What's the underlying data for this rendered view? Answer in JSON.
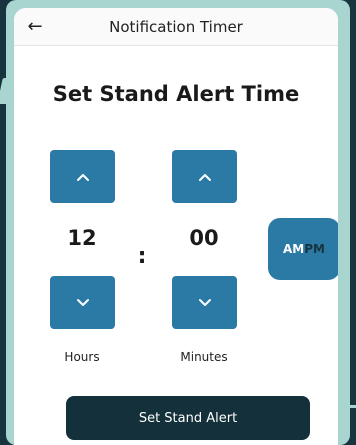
{
  "appbar": {
    "title": "Notification Timer",
    "back_icon": "←"
  },
  "heading": "Set Stand Alert Time",
  "hours": {
    "value": "12",
    "label": "Hours"
  },
  "minutes": {
    "value": "00",
    "label": "Minutes"
  },
  "separator": ":",
  "period": {
    "am": "AM",
    "pm": "PM",
    "selected": "AM"
  },
  "cta_label": "Set Stand Alert",
  "colors": {
    "background": "#17343f",
    "frame": "#a8d5d0",
    "accent": "#2b7aa5",
    "cta": "#14303b"
  },
  "icons": {
    "back": "arrow-left-icon",
    "increment": "chevron-up-icon",
    "decrement": "chevron-down-icon"
  }
}
